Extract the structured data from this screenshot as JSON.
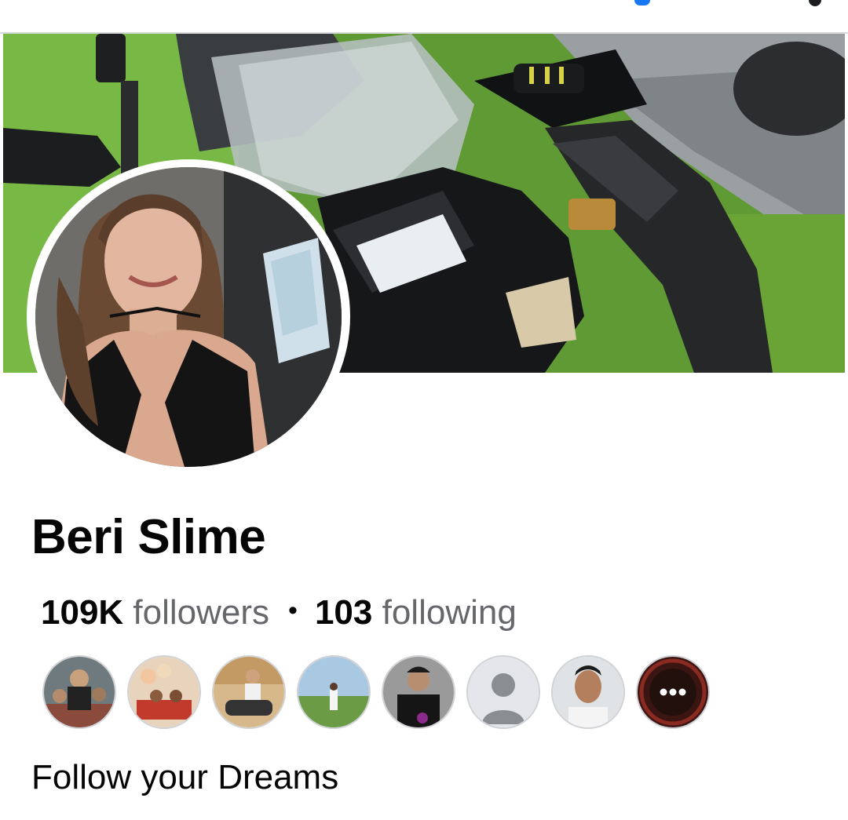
{
  "profile": {
    "name": "Beri Slime",
    "followers_count": "109K",
    "followers_label": "followers",
    "separator": "•",
    "following_count": "103",
    "following_label": "following",
    "bio": "Follow your Dreams"
  },
  "images": {
    "cover_photo": "person riding black sport motorcycle on roadside with grass",
    "profile_photo": "smiling woman with long brown hair in car"
  },
  "mutual_followers": [
    {
      "thumbnail": "group of riders with motorcycle"
    },
    {
      "thumbnail": "family celebration with balloons"
    },
    {
      "thumbnail": "person sitting on scooter"
    },
    {
      "thumbnail": "person standing in field"
    },
    {
      "thumbnail": "person in dark shirt"
    },
    {
      "thumbnail": "default-avatar-icon"
    },
    {
      "thumbnail": "man portrait"
    },
    {
      "thumbnail": "more-icon",
      "label": "•••"
    }
  ],
  "colors": {
    "text_primary": "#050505",
    "text_secondary": "#65676b",
    "accent": "#1877f2"
  }
}
